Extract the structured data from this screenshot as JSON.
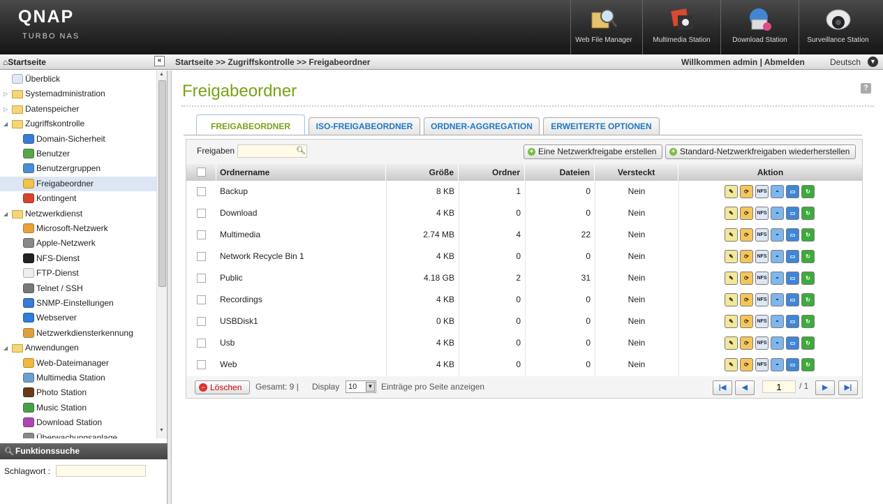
{
  "header": {
    "logo": "QNAP",
    "logo_sub": "Turbo NAS",
    "apps": [
      {
        "label": "Web File Manager",
        "icon": "web-file-manager-icon"
      },
      {
        "label": "Multimedia Station",
        "icon": "multimedia-station-icon"
      },
      {
        "label": "Download Station",
        "icon": "download-station-icon"
      },
      {
        "label": "Surveillance Station",
        "icon": "surveillance-station-icon"
      }
    ]
  },
  "topbar": {
    "home": "Startseite",
    "collapse": "«",
    "breadcrumb": "Startseite >> Zugriffskontrolle >> Freigabeordner",
    "welcome": "Willkommen admin | Abmelden",
    "language": "Deutsch"
  },
  "sidebar": {
    "items": [
      {
        "label": "Überblick",
        "level": 0,
        "icon": "overview-icon"
      },
      {
        "label": "Systemadministration",
        "level": 0,
        "icon": "folder-icon",
        "twisty": "▷"
      },
      {
        "label": "Datenspeicher",
        "level": 0,
        "icon": "folder-icon",
        "twisty": "▷"
      },
      {
        "label": "Zugriffskontrolle",
        "level": 0,
        "icon": "folder-open-icon",
        "twisty": "◢"
      },
      {
        "label": "Domain-Sicherheit",
        "level": 1,
        "icon": "domain-security-icon"
      },
      {
        "label": "Benutzer",
        "level": 1,
        "icon": "user-icon"
      },
      {
        "label": "Benutzergruppen",
        "level": 1,
        "icon": "user-groups-icon"
      },
      {
        "label": "Freigabeordner",
        "level": 1,
        "icon": "share-folder-icon",
        "selected": true
      },
      {
        "label": "Kontingent",
        "level": 1,
        "icon": "quota-icon"
      },
      {
        "label": "Netzwerkdienst",
        "level": 0,
        "icon": "folder-open-icon",
        "twisty": "◢"
      },
      {
        "label": "Microsoft-Netzwerk",
        "level": 1,
        "icon": "windows-icon"
      },
      {
        "label": "Apple-Netzwerk",
        "level": 1,
        "icon": "apple-icon"
      },
      {
        "label": "NFS-Dienst",
        "level": 1,
        "icon": "linux-penguin-icon"
      },
      {
        "label": "FTP-Dienst",
        "level": 1,
        "icon": "ftp-icon"
      },
      {
        "label": "Telnet / SSH",
        "level": 1,
        "icon": "terminal-icon"
      },
      {
        "label": "SNMP-Einstellungen",
        "level": 1,
        "icon": "snmp-icon"
      },
      {
        "label": "Webserver",
        "level": 1,
        "icon": "globe-icon"
      },
      {
        "label": "Netzwerkdiensterkennung",
        "level": 1,
        "icon": "service-discovery-icon"
      },
      {
        "label": "Anwendungen",
        "level": 0,
        "icon": "folder-open-icon",
        "twisty": "◢"
      },
      {
        "label": "Web-Dateimanager",
        "level": 1,
        "icon": "web-file-manager-icon"
      },
      {
        "label": "Multimedia Station",
        "level": 1,
        "icon": "multimedia-icon"
      },
      {
        "label": "Photo Station",
        "level": 1,
        "icon": "photo-icon"
      },
      {
        "label": "Music Station",
        "level": 1,
        "icon": "music-icon"
      },
      {
        "label": "Download Station",
        "level": 1,
        "icon": "download-icon"
      },
      {
        "label": "Überwachungsanlage",
        "level": 1,
        "icon": "surveillance-icon"
      }
    ]
  },
  "funktionssuche": {
    "title": "Funktionssuche",
    "keyword_label": "Schlagwort :",
    "keyword_value": ""
  },
  "main": {
    "title": "Freigabeordner",
    "help": "?",
    "tabs": [
      {
        "label": "FREIGABEORDNER",
        "active": true
      },
      {
        "label": "ISO-FREIGABEORDNER"
      },
      {
        "label": "ORDNER-AGGREGATION"
      },
      {
        "label": "ERWEITERTE OPTIONEN"
      }
    ],
    "filter_label": "Freigaben",
    "filter_value": "",
    "create_button": "Eine Netzwerkfreigabe erstellen",
    "restore_button": "Standard-Netzwerkfreigaben wiederherstellen",
    "columns": [
      "Ordnername",
      "Größe",
      "Ordner",
      "Dateien",
      "Versteckt",
      "Aktion"
    ],
    "rows": [
      {
        "name": "Backup",
        "size": "8 KB",
        "folders": "1",
        "files": "0",
        "hidden": "Nein"
      },
      {
        "name": "Download",
        "size": "4 KB",
        "folders": "0",
        "files": "0",
        "hidden": "Nein"
      },
      {
        "name": "Multimedia",
        "size": "2.74 MB",
        "folders": "4",
        "files": "22",
        "hidden": "Nein"
      },
      {
        "name": "Network Recycle Bin 1",
        "size": "4 KB",
        "folders": "0",
        "files": "0",
        "hidden": "Nein"
      },
      {
        "name": "Public",
        "size": "4.18 GB",
        "folders": "2",
        "files": "31",
        "hidden": "Nein"
      },
      {
        "name": "Recordings",
        "size": "4 KB",
        "folders": "0",
        "files": "0",
        "hidden": "Nein"
      },
      {
        "name": "USBDisk1",
        "size": "0 KB",
        "folders": "0",
        "files": "0",
        "hidden": "Nein"
      },
      {
        "name": "Usb",
        "size": "4 KB",
        "folders": "0",
        "files": "0",
        "hidden": "Nein"
      },
      {
        "name": "Web",
        "size": "4 KB",
        "folders": "0",
        "files": "0",
        "hidden": "Nein"
      }
    ],
    "actions": [
      {
        "name": "edit-properties-icon",
        "glyph": "✎",
        "bg": "#f3e79a"
      },
      {
        "name": "access-rights-icon",
        "glyph": "⟳",
        "bg": "#f6c55a"
      },
      {
        "name": "nfs-icon",
        "glyph": "NFS",
        "bg": "#dde7f5"
      },
      {
        "name": "network-access-icon",
        "glyph": "◓",
        "bg": "#7eb6ef"
      },
      {
        "name": "monitor-icon",
        "glyph": "▭",
        "bg": "#3f86d6"
      },
      {
        "name": "refresh-icon",
        "glyph": "↻",
        "bg": "#3cab3c"
      }
    ],
    "delete_button": "Löschen",
    "total": "Gesamt: 9  |",
    "display_label": "Display",
    "display_value": "10",
    "per_page": "Einträge pro Seite anzeigen",
    "page_value": "1",
    "page_of": "/ 1"
  }
}
